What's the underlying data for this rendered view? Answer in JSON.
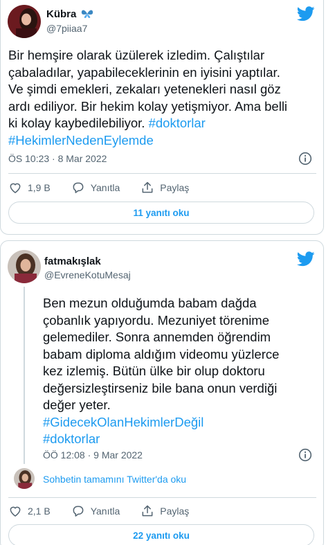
{
  "tweets": [
    {
      "name": "Kübra",
      "name_emoji": "butterfly-emoji",
      "handle": "@7piiaa7",
      "text": "Bir hemşire olarak üzülerek izledim. Çalıştılar\nçabaladılar, yapabileceklerinin en iyisini yaptılar.\nVe şimdi emekleri, zekaları yetenekleri nasıl göz\nardı ediliyor. Bir hekim kolay yetişmiyor. Ama belli\nki kolay kaybedilebiliyor. ",
      "inline_hashtag": "#doktorlar",
      "hashtags": [
        "#HekimlerNedenEylemde"
      ],
      "timestamp": "ÖS 10:23 · 8 Mar 2022",
      "likes": "1,9 B",
      "reply_label": "Yanıtla",
      "share_label": "Paylaş",
      "read_replies": "11 yanıtı oku"
    },
    {
      "name": "fatmakışlak",
      "handle": "@EvreneKotuMesaj",
      "text": "Ben mezun olduğumda babam dağda\nçobanlık yapıyordu. Mezuniyet törenime\ngelemediler. Sonra annemden öğrendim\nbabam diploma aldığım videomu yüzlerce\nkez izlemiş. Bütün ülke bir olup doktoru\ndeğersizleştirseniz bile bana onun verdiği\ndeğer yeter.",
      "hashtags": [
        "#GidecekOlanHekimlerDeğil",
        "#doktorlar"
      ],
      "timestamp": "ÖÖ 12:08 · 9 Mar 2022",
      "thread_link": "Sohbetin tamamını Twitter'da oku",
      "likes": "2,1 B",
      "reply_label": "Yanıtla",
      "share_label": "Paylaş",
      "read_replies": "22 yanıtı oku"
    }
  ],
  "colors": {
    "accent": "#1d9bf0",
    "text": "#0f1419",
    "muted": "#536471",
    "border": "#cfd9de"
  }
}
